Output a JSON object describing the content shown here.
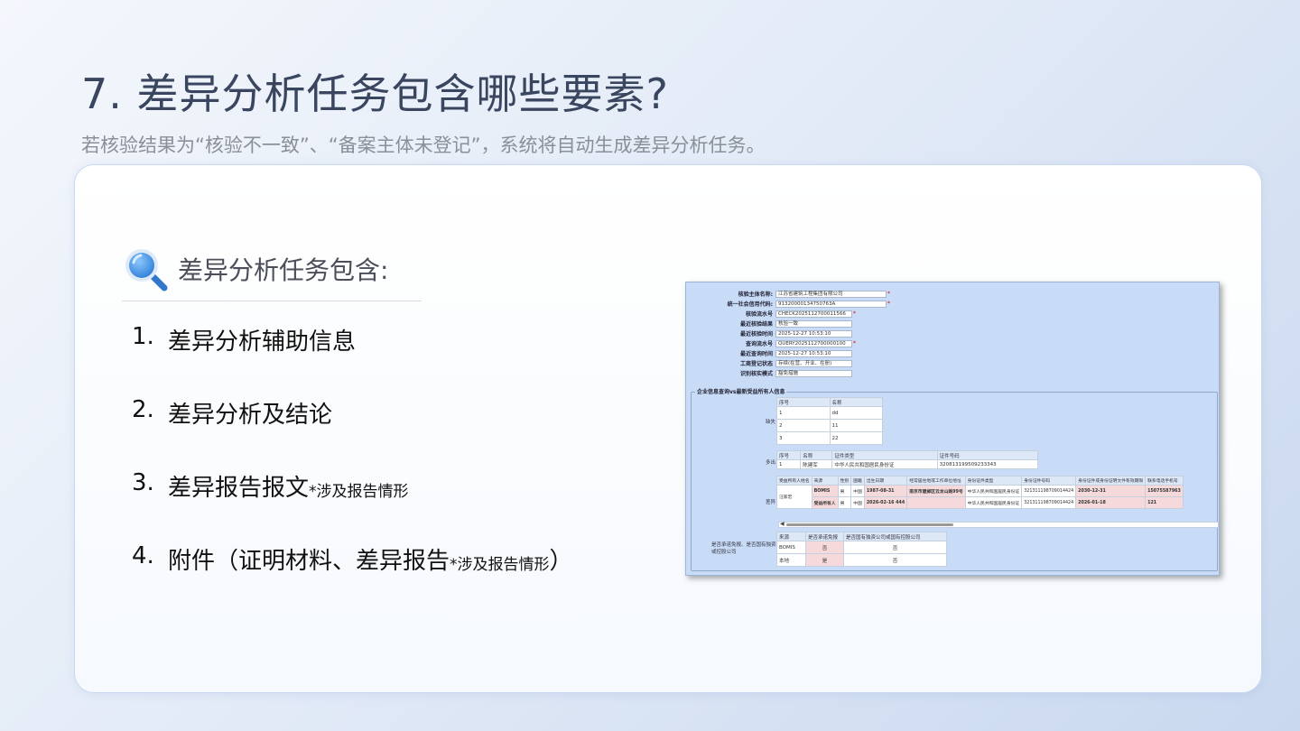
{
  "title": "7. 差异分析任务包含哪些要素?",
  "subtitle": "若核验结果为“核验不一致”、“备案主体未登记”，系统将自动生成差异分析任务。",
  "section": {
    "heading": "差异分析任务包含:",
    "items": [
      {
        "num": "1.",
        "text": "差异分析辅助信息",
        "note": "",
        "tail": ""
      },
      {
        "num": "2.",
        "text": "差异分析及结论",
        "note": "",
        "tail": ""
      },
      {
        "num": "3.",
        "text": "差异报告报文",
        "note": "*涉及报告情形",
        "tail": ""
      },
      {
        "num": "4.",
        "text": "附件（证明材料、差异报告",
        "note": "*涉及报告情形",
        "tail": "）"
      }
    ]
  },
  "form": {
    "fields": [
      {
        "label": "核验主体名称:",
        "value": "江苏省建筑工程集团有限公司",
        "star": "*"
      },
      {
        "label": "统一社会信用代码:",
        "value": "91320000134750763A",
        "star": "*"
      },
      {
        "label": "核验流水号",
        "value": "CHECK2025112700011566",
        "star": "*"
      },
      {
        "label": "最近核验结果",
        "value": "核验一致",
        "star": ""
      },
      {
        "label": "最近核验时间",
        "value": "2025-12-27 10:53:10",
        "star": ""
      },
      {
        "label": "查询流水号",
        "value": "QUERY2025112700000100",
        "star": "*"
      },
      {
        "label": "最近查询时间",
        "value": "2025-12-27 10:53:10",
        "star": ""
      },
      {
        "label": "工商登记状态",
        "value": "存续(在营、开业、在册)",
        "star": ""
      },
      {
        "label": "识别核实模式",
        "value": "豁免措施",
        "star": ""
      }
    ],
    "legend": "企业信息查询vs最新受益所有人信息",
    "missing": {
      "label": "缺失",
      "headers": [
        "序号",
        "名称"
      ],
      "rows": [
        [
          "1",
          "dd"
        ],
        [
          "2",
          "11"
        ],
        [
          "3",
          "22"
        ]
      ]
    },
    "extra": {
      "label": "多出",
      "headers": [
        "序号",
        "名称",
        "证件类型",
        "证件号码"
      ],
      "rows": [
        [
          "1",
          "陈建军",
          "中华人民共和国居民身份证",
          "320813199509233343"
        ]
      ]
    },
    "diff": {
      "label": "差异",
      "headers": [
        "受益所有人姓名",
        "来源",
        "性别",
        "国籍",
        "出生日期",
        "经常居住地或工作单位地址",
        "身份证件类型",
        "身份证件号码",
        "身份证件或身份证明文件有效期限",
        "联系电话手机号"
      ],
      "name": "汪家宏",
      "rows": [
        [
          "BOMIS",
          "男",
          "中国",
          "1987-08-31",
          "南京市建邺区云龙山路99号",
          "中华人民共和国居民身份证",
          "321311198709014424",
          "2030-12-31",
          "15075587963"
        ],
        [
          "受益所有人",
          "男",
          "中国",
          "2026-02-16 444",
          "",
          "中华人民共和国居民身份证",
          "321311198709014424",
          "2026-01-18",
          "121"
        ]
      ]
    },
    "state": {
      "label": "是否承诺免报、是否国有独资或控股公司",
      "headers": [
        "来源",
        "是否承诺免报",
        "是否国有独资公司或国有控股公司"
      ],
      "rows": [
        [
          "BOMIS",
          "否",
          "否"
        ],
        [
          "本地",
          "是",
          "否"
        ]
      ]
    }
  },
  "colors": {
    "accent": "#3f8fe0",
    "title": "#3a4660",
    "screenshot_bg": "#c9dcf7",
    "mismatch": "#f6d9da"
  }
}
